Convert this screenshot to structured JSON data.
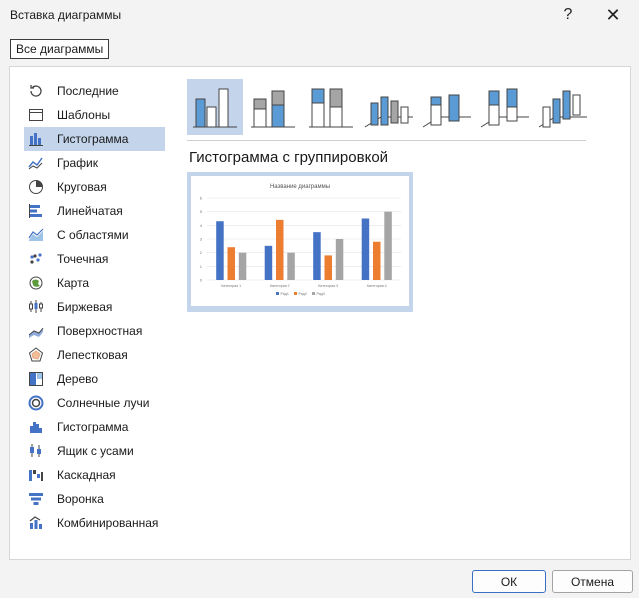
{
  "window": {
    "title": "Вставка диаграммы",
    "help_label": "?",
    "close_label": "✕"
  },
  "tab": {
    "label": "Все диаграммы"
  },
  "categories": [
    {
      "label": "Последние",
      "icon": "recent-icon"
    },
    {
      "label": "Шаблоны",
      "icon": "templates-icon"
    },
    {
      "label": "Гистограмма",
      "icon": "column-chart-icon",
      "selected": true
    },
    {
      "label": "График",
      "icon": "line-chart-icon"
    },
    {
      "label": "Круговая",
      "icon": "pie-chart-icon"
    },
    {
      "label": "Линейчатая",
      "icon": "bar-chart-icon"
    },
    {
      "label": "С областями",
      "icon": "area-chart-icon"
    },
    {
      "label": "Точечная",
      "icon": "scatter-chart-icon"
    },
    {
      "label": "Карта",
      "icon": "map-chart-icon"
    },
    {
      "label": "Биржевая",
      "icon": "stock-chart-icon"
    },
    {
      "label": "Поверхностная",
      "icon": "surface-chart-icon"
    },
    {
      "label": "Лепестковая",
      "icon": "radar-chart-icon"
    },
    {
      "label": "Дерево",
      "icon": "treemap-chart-icon"
    },
    {
      "label": "Солнечные лучи",
      "icon": "sunburst-chart-icon"
    },
    {
      "label": "Гистограмма",
      "icon": "histogram-chart-icon"
    },
    {
      "label": "Ящик с усами",
      "icon": "box-whisker-chart-icon"
    },
    {
      "label": "Каскадная",
      "icon": "waterfall-chart-icon"
    },
    {
      "label": "Воронка",
      "icon": "funnel-chart-icon"
    },
    {
      "label": "Комбинированная",
      "icon": "combo-chart-icon"
    }
  ],
  "subtype_title": "Гистограмма с группировкой",
  "subtypes": [
    {
      "icon": "clustered-column-icon",
      "selected": true
    },
    {
      "icon": "stacked-column-icon"
    },
    {
      "icon": "stacked-100-column-icon"
    },
    {
      "icon": "3d-clustered-column-icon"
    },
    {
      "icon": "3d-stacked-column-icon"
    },
    {
      "icon": "3d-stacked-100-column-icon"
    },
    {
      "icon": "3d-column-icon"
    }
  ],
  "chart_data": {
    "type": "bar",
    "title": "Название диаграммы",
    "categories": [
      "Категория 1",
      "Категория 2",
      "Категория 3",
      "Категория 4"
    ],
    "series": [
      {
        "name": "Ряд1",
        "values": [
          4.3,
          2.5,
          3.5,
          4.5
        ],
        "color": "#4472c4"
      },
      {
        "name": "Ряд2",
        "values": [
          2.4,
          4.4,
          1.8,
          2.8
        ],
        "color": "#ed7d31"
      },
      {
        "name": "Ряд3",
        "values": [
          2,
          2,
          3,
          5
        ],
        "color": "#a5a5a5"
      }
    ],
    "ylim": [
      0,
      6
    ],
    "yticks": [
      "0",
      "1",
      "2",
      "3",
      "4",
      "5",
      "6"
    ],
    "legend": "bottom",
    "grid": true
  },
  "buttons": {
    "ok": "ОК",
    "cancel": "Отмена"
  },
  "colors": {
    "accent": "#4472c4",
    "selection": "#c4d5eb"
  }
}
